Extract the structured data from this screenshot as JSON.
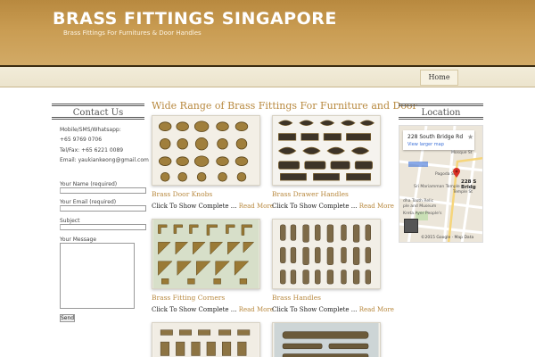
{
  "header": {
    "title": "BRASS FITTINGS SINGAPORE",
    "tagline": "Brass Fittings For Furnitures & Door Handles"
  },
  "nav": {
    "home": "Home"
  },
  "contact": {
    "title": "Contact Us",
    "mobile_label": "Mobile/SMS/Whatsapp:",
    "mobile_value": "+65 9769 0706",
    "tel_fax": "Tel/Fax: +65 6221 0089",
    "email": "Email: yaukiankeong@gmail.com",
    "form": {
      "name_label": "Your Name (required)",
      "email_label": "Your Email (required)",
      "subject_label": "Subject",
      "message_label": "Your Message",
      "send_label": "Send"
    }
  },
  "main": {
    "heading": "Wide Range of Brass Fittings For Furniture and Door",
    "items": [
      {
        "title": "Brass Door Knobs",
        "desc": "Click To Show Complete ...",
        "more": "Read More"
      },
      {
        "title": "Brass Drawer Handles",
        "desc": "Click To Show Complete ...",
        "more": "Read More"
      },
      {
        "title": "Brass Fitting Corners",
        "desc": "Click To Show Complete ...",
        "more": "Read More"
      },
      {
        "title": "Brass Handles",
        "desc": "Click To Show Complete ...",
        "more": "Read More"
      }
    ]
  },
  "location": {
    "title": "Location",
    "map": {
      "address": "228 South Bridge Rd",
      "view_larger": "View larger map",
      "pin_label": "228 S Bridg",
      "street_1": "Mosque St",
      "street_2": "Pagoda St",
      "street_3": "Temple St",
      "landmark_1": "Sri Mariamman Temple",
      "landmark_2": "dha Tooth Relic",
      "landmark_3": "ple and Museum",
      "landmark_4": "Kreta Ayer People's",
      "footer": "©2015 Google · Map Data"
    }
  },
  "colors": {
    "brand": "#b8893f",
    "link": "#b8893f",
    "map_pin": "#d93025"
  }
}
